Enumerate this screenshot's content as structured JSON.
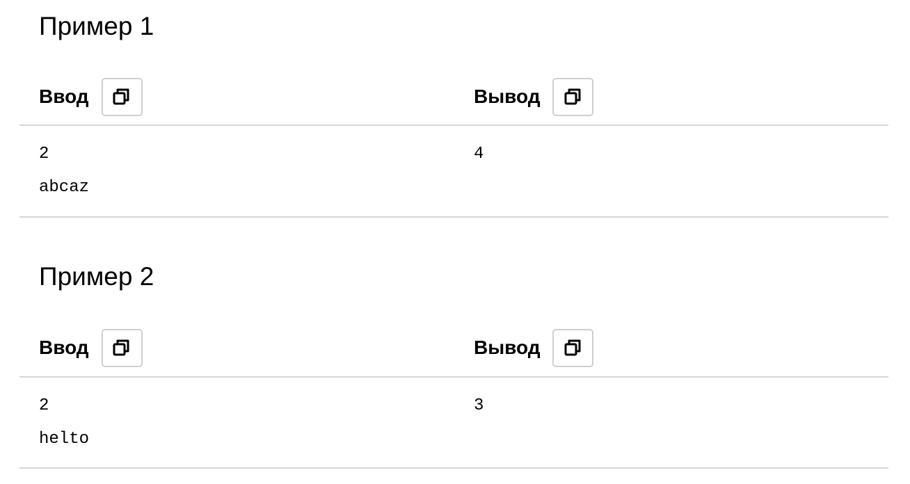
{
  "examples": [
    {
      "title": "Пример 1",
      "input_label": "Ввод",
      "output_label": "Вывод",
      "input_lines": [
        "2",
        "abcaz"
      ],
      "output_lines": [
        "4"
      ]
    },
    {
      "title": "Пример 2",
      "input_label": "Ввод",
      "output_label": "Вывод",
      "input_lines": [
        "2",
        "helto"
      ],
      "output_lines": [
        "3"
      ]
    }
  ],
  "icons": {
    "copy": "copy-icon"
  },
  "colors": {
    "divider": "#d6d6d6",
    "button_border": "#cfcfcf",
    "text": "#000000"
  }
}
